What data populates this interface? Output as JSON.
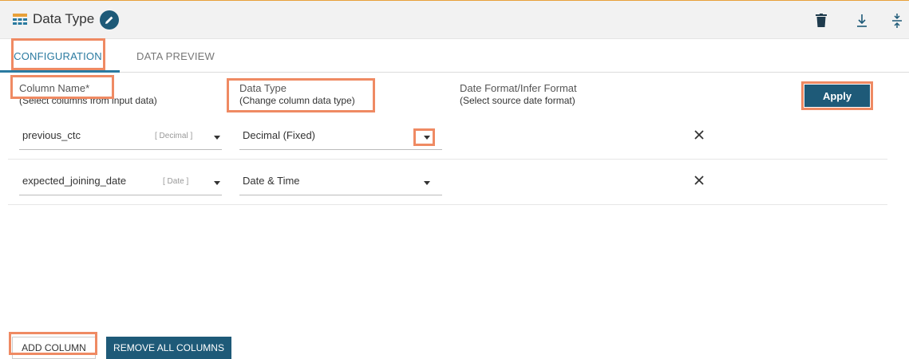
{
  "header": {
    "title": "Data Type",
    "icon": "grid-table-icon",
    "edit_icon": "pencil-icon",
    "actions": [
      "trash-icon",
      "download-icon",
      "collapse-icon"
    ]
  },
  "tabs": [
    {
      "label": "CONFIGURATION",
      "active": true
    },
    {
      "label": "DATA PREVIEW",
      "active": false
    }
  ],
  "columns": {
    "column_name": {
      "title": "Column Name*",
      "subtitle": "(Select columns from input data)"
    },
    "data_type": {
      "title": "Data Type",
      "subtitle": "(Change column data type)"
    },
    "date_format": {
      "title": "Date Format/Infer Format",
      "subtitle": "(Select source date format)"
    }
  },
  "apply_label": "Apply",
  "rows": [
    {
      "column": "previous_ctc",
      "source_type": "[ Decimal ]",
      "data_type": "Decimal (Fixed)"
    },
    {
      "column": "expected_joining_date",
      "source_type": "[ Date ]",
      "data_type": "Date & Time"
    }
  ],
  "footer": {
    "add_column": "ADD COLUMN",
    "remove_all": "REMOVE ALL COLUMNS"
  },
  "colors": {
    "accent": "#1e5a78",
    "tab_active": "#2a7aa0",
    "highlight": "#ef8a63",
    "top_border": "#e8a13a"
  }
}
